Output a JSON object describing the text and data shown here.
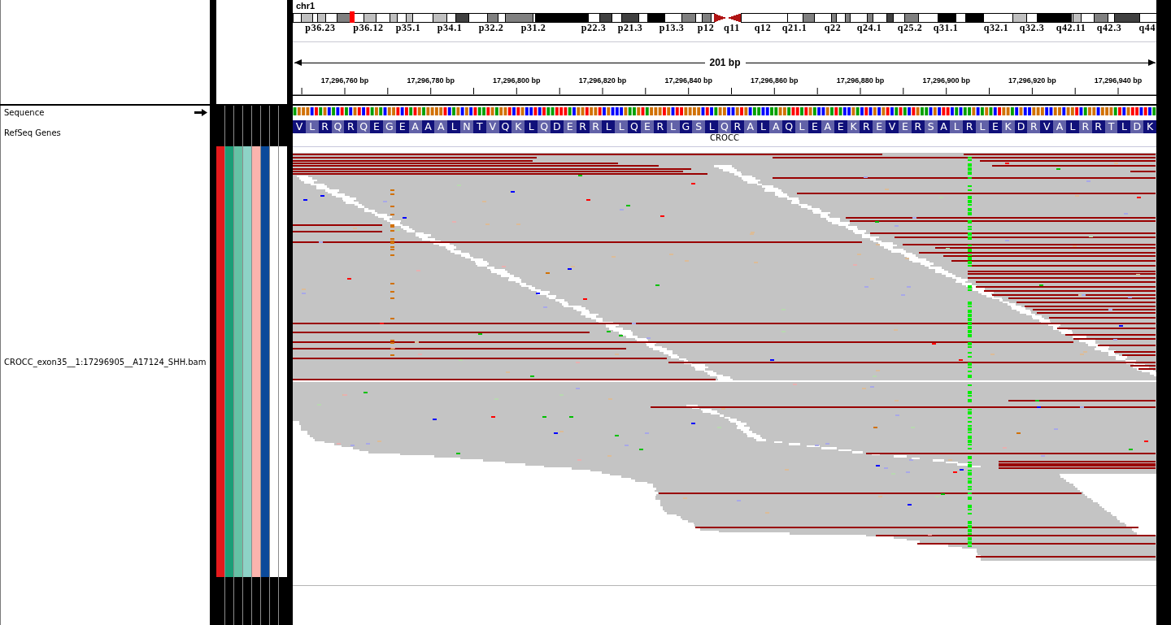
{
  "header": {
    "chromosome": "chr1",
    "bands": [
      {
        "label": "p36.23"
      },
      {
        "label": "p36.12"
      },
      {
        "label": "p35.1"
      },
      {
        "label": "p34.1"
      },
      {
        "label": "p32.2"
      },
      {
        "label": "p31.2"
      },
      {
        "label": "p22.3"
      },
      {
        "label": "p21.3"
      },
      {
        "label": "p13.3"
      },
      {
        "label": "p12"
      },
      {
        "label": "q11"
      },
      {
        "label": "q12"
      },
      {
        "label": "q21.1"
      },
      {
        "label": "q22"
      },
      {
        "label": "q24.1"
      },
      {
        "label": "q25.2"
      },
      {
        "label": "q31.1"
      },
      {
        "label": "q32.1"
      },
      {
        "label": "q32.3"
      },
      {
        "label": "q42.11"
      },
      {
        "label": "q42.3"
      },
      {
        "label": "q44"
      }
    ],
    "span": "201 bp",
    "ruler_ticks": [
      "17,296,760 bp",
      "17,296,780 bp",
      "17,296,800 bp",
      "17,296,820 bp",
      "17,296,840 bp",
      "17,296,860 bp",
      "17,296,880 bp",
      "17,296,900 bp",
      "17,296,920 bp",
      "17,296,940 bp"
    ]
  },
  "tracks": [
    {
      "kind": "sequence",
      "name": "Sequence",
      "reverse_strand": false
    },
    {
      "kind": "gene",
      "name": "RefSeq Genes",
      "amino_acids": [
        "V",
        "L",
        "R",
        "Q",
        "R",
        "Q",
        "E",
        "G",
        "E",
        "A",
        "A",
        "A",
        "L",
        "N",
        "T",
        "V",
        "Q",
        "K",
        "L",
        "Q",
        "D",
        "E",
        "R",
        "R",
        "L",
        "L",
        "Q",
        "E",
        "R",
        "L",
        "G",
        "S",
        "L",
        "Q",
        "R",
        "A",
        "L",
        "A",
        "Q",
        "L",
        "E",
        "A",
        "E",
        "K",
        "R",
        "E",
        "V",
        "E",
        "R",
        "S",
        "A",
        "L",
        "R",
        "L",
        "E",
        "K",
        "D",
        "R",
        "V",
        "A",
        "L",
        "R",
        "R",
        "T",
        "L",
        "D",
        "K"
      ],
      "gene": "CROCC"
    },
    {
      "kind": "alignment",
      "name": "CROCC_exon35__1:17296905__A17124_SHH.bam",
      "attributes": [
        {
          "color": "#e41a1c"
        },
        {
          "color": "#1b9e77"
        },
        {
          "color": "#66c2a5"
        },
        {
          "color": "#8dd3c7"
        },
        {
          "color": "#fbb4ae"
        },
        {
          "color": "#0b4a9a"
        },
        {
          "color": "#ffffff"
        },
        {
          "color": "#ffffff"
        }
      ]
    }
  ]
}
